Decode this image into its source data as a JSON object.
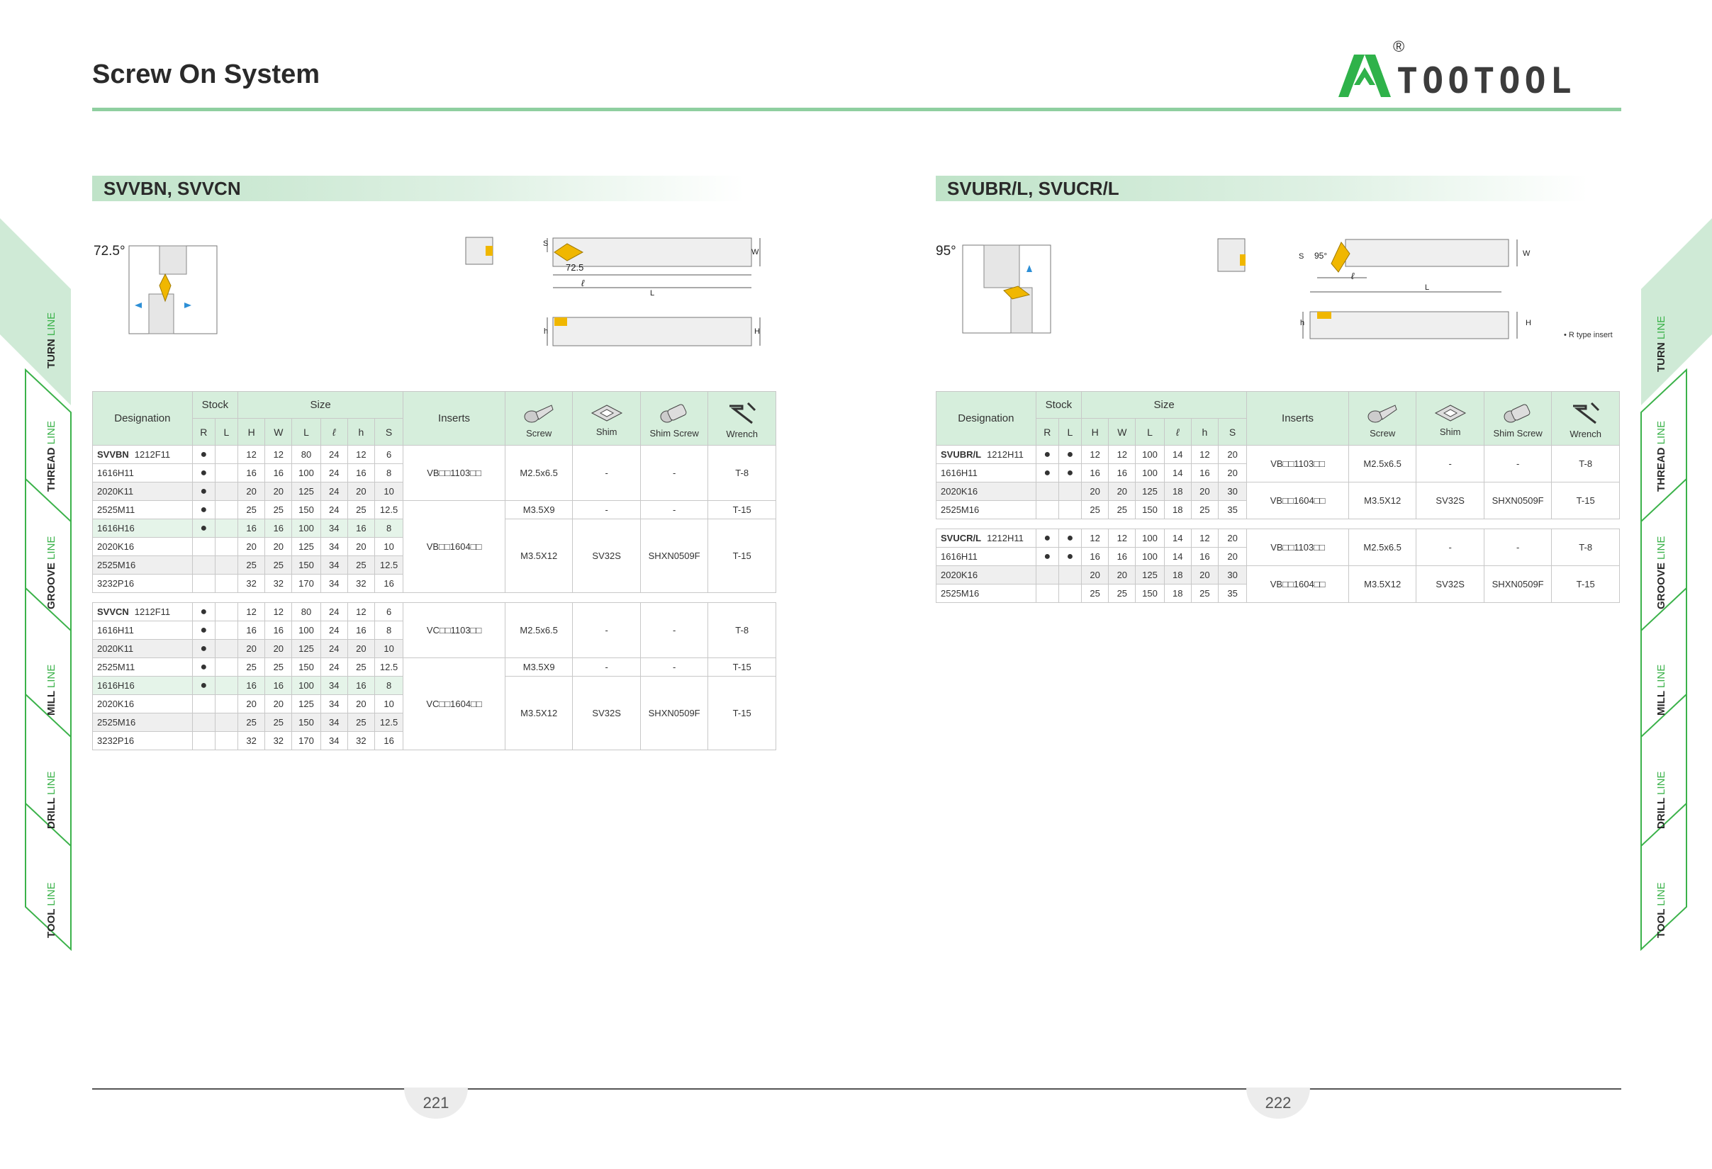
{
  "page_title": "Screw On System",
  "logo": {
    "text": "TOOTOOL",
    "reg": "®",
    "color": "#2fb24a"
  },
  "left_section": {
    "title": "SVVBN, SVVCN",
    "angle": "72.5°",
    "dim_angle": "72.5",
    "dims": {
      "s": "S",
      "w": "W",
      "l": "L",
      "ell": "ℓ",
      "h": "h",
      "H": "H"
    }
  },
  "right_section": {
    "title": "SVUBR/L, SVUCR/L",
    "angle": "95°",
    "dim_angle": "95°",
    "dims": {
      "s": "S",
      "w": "W",
      "l": "L",
      "ell": "ℓ",
      "h": "h",
      "H": "H"
    },
    "note": "• R type insert"
  },
  "headers": {
    "designation": "Designation",
    "stock": "Stock",
    "size": "Size",
    "inserts": "Inserts",
    "r": "R",
    "l": "L",
    "H": "H",
    "W": "W",
    "Lc": "L",
    "ell": "ℓ",
    "h": "h",
    "S": "S",
    "screw": "Screw",
    "shim": "Shim",
    "shim_screw": "Shim Screw",
    "wrench": "Wrench"
  },
  "left_table": {
    "group1": {
      "name": "SVVBN",
      "rows": [
        {
          "code": "1212F11",
          "r": "●",
          "l": "",
          "H": "12",
          "W": "12",
          "L": "80",
          "ell": "24",
          "h": "12",
          "S": "6"
        },
        {
          "code": "1616H11",
          "r": "●",
          "l": "",
          "H": "16",
          "W": "16",
          "L": "100",
          "ell": "24",
          "h": "16",
          "S": "8"
        },
        {
          "code": "2020K11",
          "r": "●",
          "l": "",
          "H": "20",
          "W": "20",
          "L": "125",
          "ell": "24",
          "h": "20",
          "S": "10"
        },
        {
          "code": "2525M11",
          "r": "●",
          "l": "",
          "H": "25",
          "W": "25",
          "L": "150",
          "ell": "24",
          "h": "25",
          "S": "12.5"
        },
        {
          "code": "1616H16",
          "r": "●",
          "l": "",
          "H": "16",
          "W": "16",
          "L": "100",
          "ell": "34",
          "h": "16",
          "S": "8"
        },
        {
          "code": "2020K16",
          "r": "",
          "l": "",
          "H": "20",
          "W": "20",
          "L": "125",
          "ell": "34",
          "h": "20",
          "S": "10"
        },
        {
          "code": "2525M16",
          "r": "",
          "l": "",
          "H": "25",
          "W": "25",
          "L": "150",
          "ell": "34",
          "h": "25",
          "S": "12.5"
        },
        {
          "code": "3232P16",
          "r": "",
          "l": "",
          "H": "32",
          "W": "32",
          "L": "170",
          "ell": "34",
          "h": "32",
          "S": "16"
        }
      ],
      "insert_a": "VB□□1103□□",
      "insert_b": "VB□□1604□□",
      "block1": {
        "screw": "M2.5x6.5",
        "shim": "-",
        "shim_screw": "-",
        "wrench": "T-8"
      },
      "block2": {
        "screw": "M3.5X9",
        "shim": "-",
        "shim_screw": "-",
        "wrench": "T-15"
      },
      "block3": {
        "screw": "M3.5X12",
        "shim": "SV32S",
        "shim_screw": "SHXN0509F",
        "wrench": "T-15"
      }
    },
    "group2": {
      "name": "SVVCN",
      "rows": [
        {
          "code": "1212F11",
          "r": "●",
          "l": "",
          "H": "12",
          "W": "12",
          "L": "80",
          "ell": "24",
          "h": "12",
          "S": "6"
        },
        {
          "code": "1616H11",
          "r": "●",
          "l": "",
          "H": "16",
          "W": "16",
          "L": "100",
          "ell": "24",
          "h": "16",
          "S": "8"
        },
        {
          "code": "2020K11",
          "r": "●",
          "l": "",
          "H": "20",
          "W": "20",
          "L": "125",
          "ell": "24",
          "h": "20",
          "S": "10"
        },
        {
          "code": "2525M11",
          "r": "●",
          "l": "",
          "H": "25",
          "W": "25",
          "L": "150",
          "ell": "24",
          "h": "25",
          "S": "12.5"
        },
        {
          "code": "1616H16",
          "r": "●",
          "l": "",
          "H": "16",
          "W": "16",
          "L": "100",
          "ell": "34",
          "h": "16",
          "S": "8"
        },
        {
          "code": "2020K16",
          "r": "",
          "l": "",
          "H": "20",
          "W": "20",
          "L": "125",
          "ell": "34",
          "h": "20",
          "S": "10"
        },
        {
          "code": "2525M16",
          "r": "",
          "l": "",
          "H": "25",
          "W": "25",
          "L": "150",
          "ell": "34",
          "h": "25",
          "S": "12.5"
        },
        {
          "code": "3232P16",
          "r": "",
          "l": "",
          "H": "32",
          "W": "32",
          "L": "170",
          "ell": "34",
          "h": "32",
          "S": "16"
        }
      ],
      "insert_a": "VC□□1103□□",
      "insert_b": "VC□□1604□□",
      "block1": {
        "screw": "M2.5x6.5",
        "shim": "-",
        "shim_screw": "-",
        "wrench": "T-8"
      },
      "block2": {
        "screw": "M3.5X9",
        "shim": "-",
        "shim_screw": "-",
        "wrench": "T-15"
      },
      "block3": {
        "screw": "M3.5X12",
        "shim": "SV32S",
        "shim_screw": "SHXN0509F",
        "wrench": "T-15"
      }
    }
  },
  "right_table": {
    "group1": {
      "name": "SVUBR/L",
      "rows": [
        {
          "code": "1212H11",
          "r": "●",
          "l": "●",
          "H": "12",
          "W": "12",
          "L": "100",
          "ell": "14",
          "h": "12",
          "S": "20"
        },
        {
          "code": "1616H11",
          "r": "●",
          "l": "●",
          "H": "16",
          "W": "16",
          "L": "100",
          "ell": "14",
          "h": "16",
          "S": "20"
        },
        {
          "code": "2020K16",
          "r": "",
          "l": "",
          "H": "20",
          "W": "20",
          "L": "125",
          "ell": "18",
          "h": "20",
          "S": "30"
        },
        {
          "code": "2525M16",
          "r": "",
          "l": "",
          "H": "25",
          "W": "25",
          "L": "150",
          "ell": "18",
          "h": "25",
          "S": "35"
        }
      ],
      "insert_a": "VB□□1103□□",
      "insert_b": "VB□□1604□□",
      "block1": {
        "screw": "M2.5x6.5",
        "shim": "-",
        "shim_screw": "-",
        "wrench": "T-8"
      },
      "block2": {
        "screw": "M3.5X12",
        "shim": "SV32S",
        "shim_screw": "SHXN0509F",
        "wrench": "T-15"
      }
    },
    "group2": {
      "name": "SVUCR/L",
      "rows": [
        {
          "code": "1212H11",
          "r": "●",
          "l": "●",
          "H": "12",
          "W": "12",
          "L": "100",
          "ell": "14",
          "h": "12",
          "S": "20"
        },
        {
          "code": "1616H11",
          "r": "●",
          "l": "●",
          "H": "16",
          "W": "16",
          "L": "100",
          "ell": "14",
          "h": "16",
          "S": "20"
        },
        {
          "code": "2020K16",
          "r": "",
          "l": "",
          "H": "20",
          "W": "20",
          "L": "125",
          "ell": "18",
          "h": "20",
          "S": "30"
        },
        {
          "code": "2525M16",
          "r": "",
          "l": "",
          "H": "25",
          "W": "25",
          "L": "150",
          "ell": "18",
          "h": "25",
          "S": "35"
        }
      ],
      "insert_a": "VB□□1103□□",
      "insert_b": "VB□□1604□□",
      "block1": {
        "screw": "M2.5x6.5",
        "shim": "-",
        "shim_screw": "-",
        "wrench": "T-8"
      },
      "block2": {
        "screw": "M3.5X12",
        "shim": "SV32S",
        "shim_screw": "SHXN0509F",
        "wrench": "T-15"
      }
    }
  },
  "side_tabs": [
    {
      "main": "TURN",
      "accent": "LINE"
    },
    {
      "main": "THREAD",
      "accent": "LINE"
    },
    {
      "main": "GROOVE",
      "accent": "LINE"
    },
    {
      "main": "MILL",
      "accent": "LINE"
    },
    {
      "main": "DRILL",
      "accent": "LINE"
    },
    {
      "main": "TOOL",
      "accent": "LINE"
    }
  ],
  "page_numbers": {
    "left": "221",
    "right": "222"
  },
  "colors": {
    "accent_green": "#8fcfa0",
    "header_green": "#d6eedc",
    "insert_gold": "#f0b700",
    "arrow_blue": "#2d8fd6"
  }
}
